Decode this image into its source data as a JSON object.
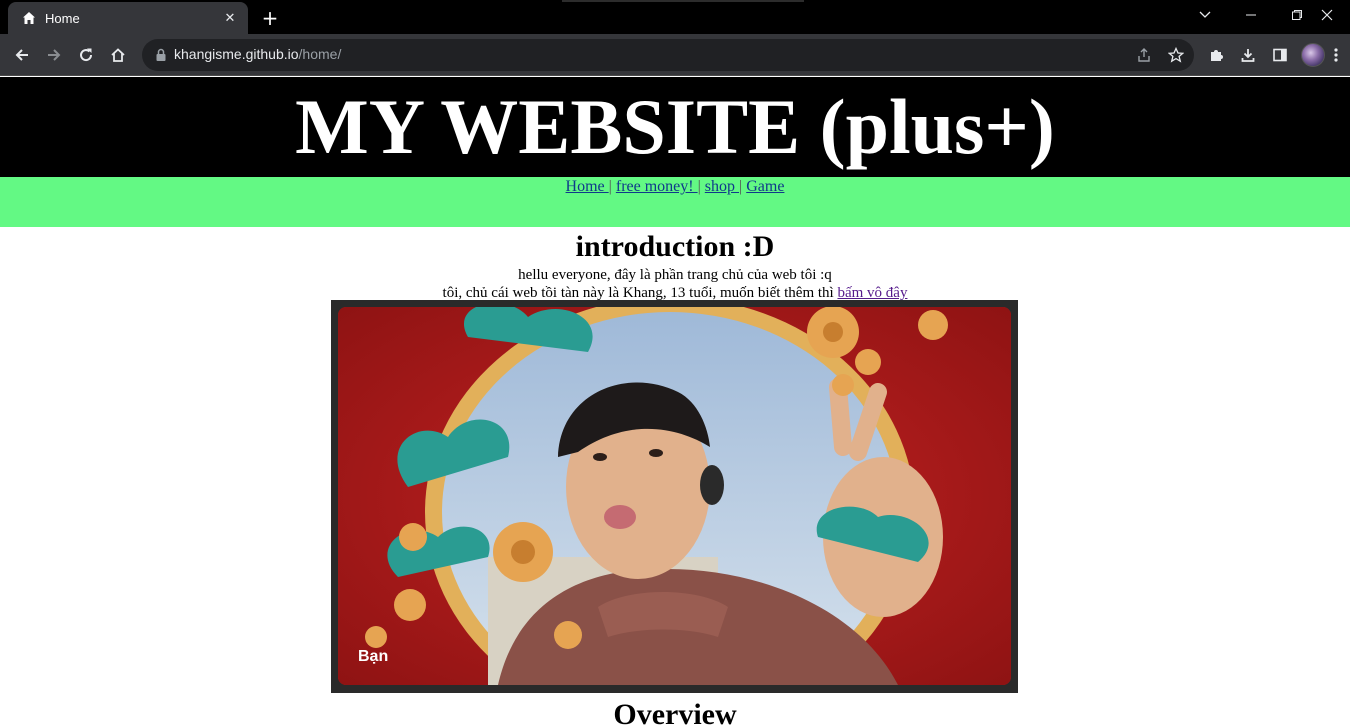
{
  "browser": {
    "tab_title": "Home",
    "new_tab_label": "+",
    "url_host": "khangisme.github.io",
    "url_path": "/home/"
  },
  "page": {
    "site_title": "MY WEBSITE (plus+)",
    "nav": [
      {
        "label": "Home "
      },
      {
        "label": "free money! "
      },
      {
        "label": "shop "
      },
      {
        "label": "Game"
      }
    ],
    "nav_separator": "|",
    "intro_heading": "introduction :D",
    "intro_line1": "hellu everyone, đây là phần trang chủ của web tôi :q",
    "intro_line2": "tôi, chủ cái web tồi tàn này là Khang, 13 tuổi, muốn biết thêm thì ",
    "intro_link": "bấm vô đây",
    "photo_caption": "Bạn",
    "overview_heading": "Overview"
  },
  "colors": {
    "header_bg": "#000000",
    "nav_bg": "#63f984",
    "photo_red": "#a91b1b",
    "gold": "#e2b05a",
    "teal": "#2a9c92"
  }
}
